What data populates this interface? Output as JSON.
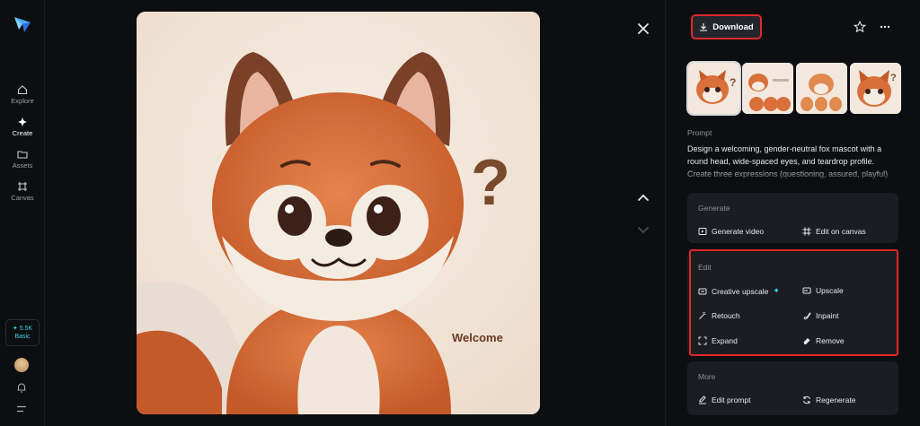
{
  "sidebar": {
    "items": [
      {
        "label": "Explore"
      },
      {
        "label": "Create"
      },
      {
        "label": "Assets"
      },
      {
        "label": "Canvas"
      }
    ],
    "credits": {
      "amount": "✦ 5.5K",
      "plan": "Basic"
    }
  },
  "viewer": {
    "image_caption": "Welcome"
  },
  "panel": {
    "download_label": "Download",
    "prompt_heading": "Prompt",
    "prompt_text": "Design a welcoming, gender-neutral fox mascot with a round head, wide-spaced eyes, and teardrop profile. Create three expressions (questioning, assured, playful)",
    "generate": {
      "title": "Generate",
      "actions": [
        "Generate video",
        "Edit on canvas"
      ]
    },
    "edit": {
      "title": "Edit",
      "actions": [
        "Creative upscale",
        "Upscale",
        "Retouch",
        "Inpaint",
        "Expand",
        "Remove"
      ]
    },
    "more": {
      "title": "More",
      "actions": [
        "Edit prompt",
        "Regenerate"
      ]
    }
  },
  "colors": {
    "accent": "#38d3e8",
    "highlight": "#e0282c",
    "background": "#0d0e11",
    "card": "#1b1d22"
  }
}
